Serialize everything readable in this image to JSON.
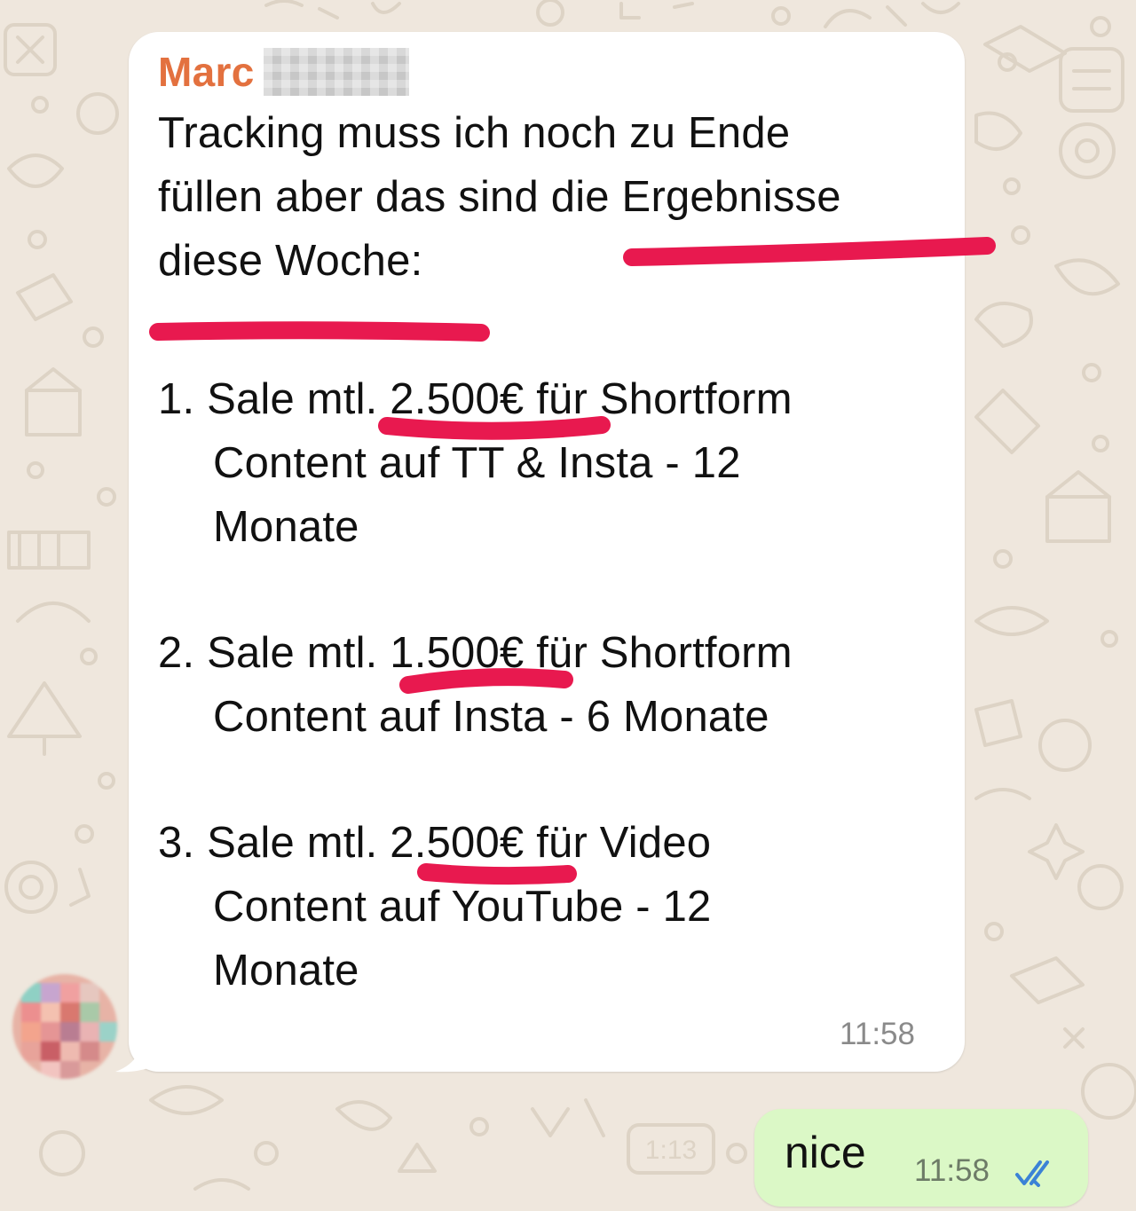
{
  "chat": {
    "incoming": {
      "sender": "Marc",
      "lines": [
        "Tracking muss ich noch zu Ende",
        "füllen aber das sind die Ergebnisse",
        "diese Woche:",
        "1. Sale mtl. 2.500€ für Shortform",
        "Content auf TT & Insta - 12",
        "Monate",
        "2. Sale mtl. 1.500€ für Shortform",
        "Content auf Insta - 6 Monate",
        "3. Sale mtl. 2.500€ für Video",
        "Content auf YouTube - 12",
        "Monate"
      ],
      "time": "11:58"
    },
    "outgoing": {
      "text": "nice",
      "time": "11:58",
      "status_icon": "double-check-read-icon"
    },
    "wallpaper_stamp": "1:13"
  },
  "colors": {
    "wallpaper": "#efe7dd",
    "incoming_bubble": "#ffffff",
    "outgoing_bubble": "#dbf8c6",
    "sender_name": "#e3713f",
    "highlight_marker": "#e8194f",
    "read_ticks": "#3b82d6"
  }
}
